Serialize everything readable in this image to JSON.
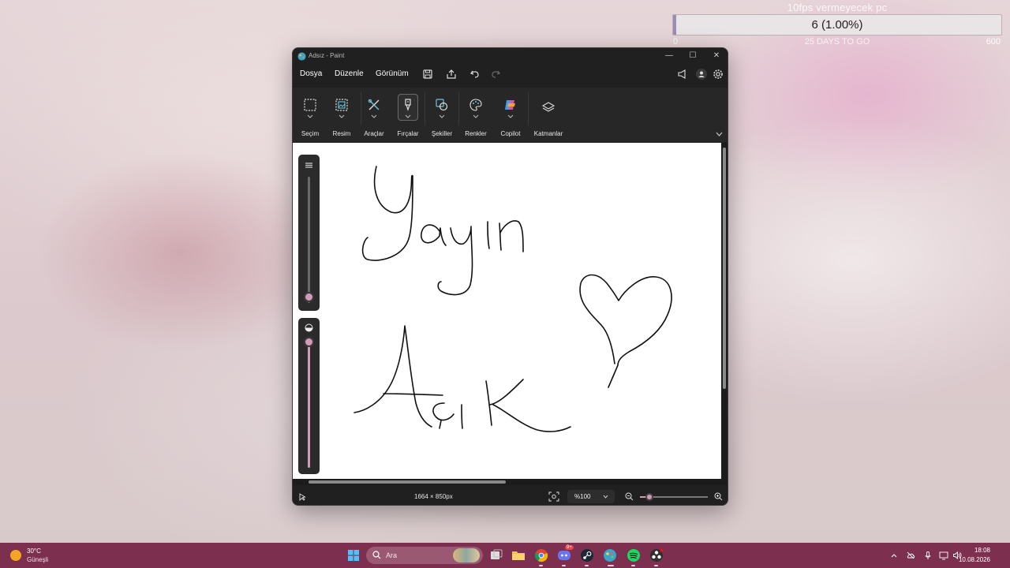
{
  "overlay": {
    "title": "10fps vermeyecek pc",
    "value_text": "6 (1.00%)",
    "progress_fraction": 0.01,
    "min": "0",
    "max": "600",
    "subtext": "25 DAYS TO GO",
    "fill_color": "#9a8bb7"
  },
  "paint": {
    "window_title": "Adsız - Paint",
    "controls": {
      "minimize": "—",
      "maximize": "☐",
      "close": "✕"
    },
    "menu": {
      "file": "Dosya",
      "edit": "Düzenle",
      "view": "Görünüm"
    },
    "toolbar_icons": [
      "save-icon",
      "share-icon",
      "undo-icon",
      "redo-icon"
    ],
    "right_icons": [
      "announce-icon",
      "account-icon",
      "settings-icon"
    ],
    "ribbon": [
      {
        "label": "Seçim",
        "icon": "selection-icon"
      },
      {
        "label": "Resim",
        "icon": "image-icon"
      },
      {
        "label": "Araçlar",
        "icon": "tools-icon"
      },
      {
        "label": "Fırçalar",
        "icon": "brush-icon",
        "active": true
      },
      {
        "label": "Şekiller",
        "icon": "shapes-icon"
      },
      {
        "label": "Renkler",
        "icon": "palette-icon"
      },
      {
        "label": "Copilot",
        "icon": "copilot-icon"
      },
      {
        "label": "Katmanlar",
        "icon": "layers-icon"
      }
    ],
    "drawing_text": [
      "Yayın",
      "Açık"
    ],
    "brush_size_level": 0.05,
    "opacity_level": 1.0,
    "status": {
      "dimensions": "1664 × 850px",
      "zoom": "%100"
    },
    "accent": "#d59ab7"
  },
  "taskbar": {
    "weather_temp": "30°C",
    "weather_desc": "Güneşli",
    "search_placeholder": "Ara",
    "apps": [
      "task-view-icon",
      "file-explorer-icon",
      "chrome-icon",
      "discord-icon",
      "steam-icon",
      "paint-icon",
      "spotify-icon",
      "obs-icon"
    ],
    "discord_badge": "9+",
    "time": "18:08",
    "date": "10.08.2026",
    "color": "#7d2f4f"
  }
}
